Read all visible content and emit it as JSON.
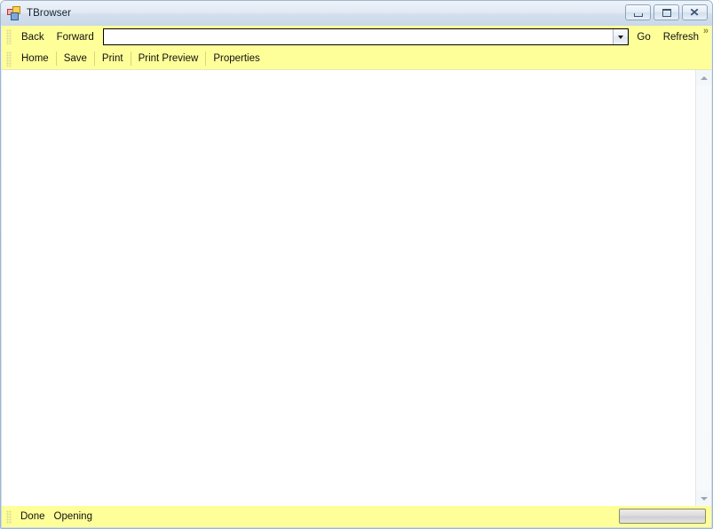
{
  "window": {
    "title": "TBrowser",
    "icon": "app-icon",
    "controls": {
      "minimize_label": "–",
      "maximize_label": "□",
      "close_label": "✕"
    }
  },
  "navigation_toolbar": {
    "grip": "drag-grip",
    "items": [
      {
        "label": "Back",
        "name": "back-button"
      },
      {
        "label": "Forward",
        "name": "forward-button"
      }
    ],
    "address": {
      "value": "",
      "placeholder": ""
    },
    "right_items": [
      {
        "label": "Go",
        "name": "go-button"
      },
      {
        "label": "Refresh",
        "name": "refresh-button"
      }
    ],
    "overflow_label": "»"
  },
  "command_toolbar": {
    "grip": "drag-grip",
    "items": [
      {
        "label": "Home",
        "name": "home-button",
        "separator_after": true
      },
      {
        "label": "Save",
        "name": "save-button",
        "separator_after": true
      },
      {
        "label": "Print",
        "name": "print-button",
        "separator_after": true
      },
      {
        "label": "Print Preview",
        "name": "print-preview-button",
        "separator_after": true
      },
      {
        "label": "Properties",
        "name": "properties-button",
        "separator_after": false
      }
    ]
  },
  "content": {
    "text": ""
  },
  "scrollbar": {
    "up_arrow": "scroll-up-arrow",
    "down_arrow": "scroll-down-arrow"
  },
  "statusbar": {
    "labels": [
      {
        "text": "Done",
        "name": "status-done-label"
      },
      {
        "text": "Opening",
        "name": "status-opening-label"
      }
    ],
    "progress": {
      "value": 0
    }
  },
  "colors": {
    "toolbar_yellow": "#ffff99",
    "title_gradient_top": "#eef3f9",
    "title_gradient_bottom": "#c9d8e9",
    "content_white": "#ffffff",
    "separator": "#d6d67e"
  }
}
